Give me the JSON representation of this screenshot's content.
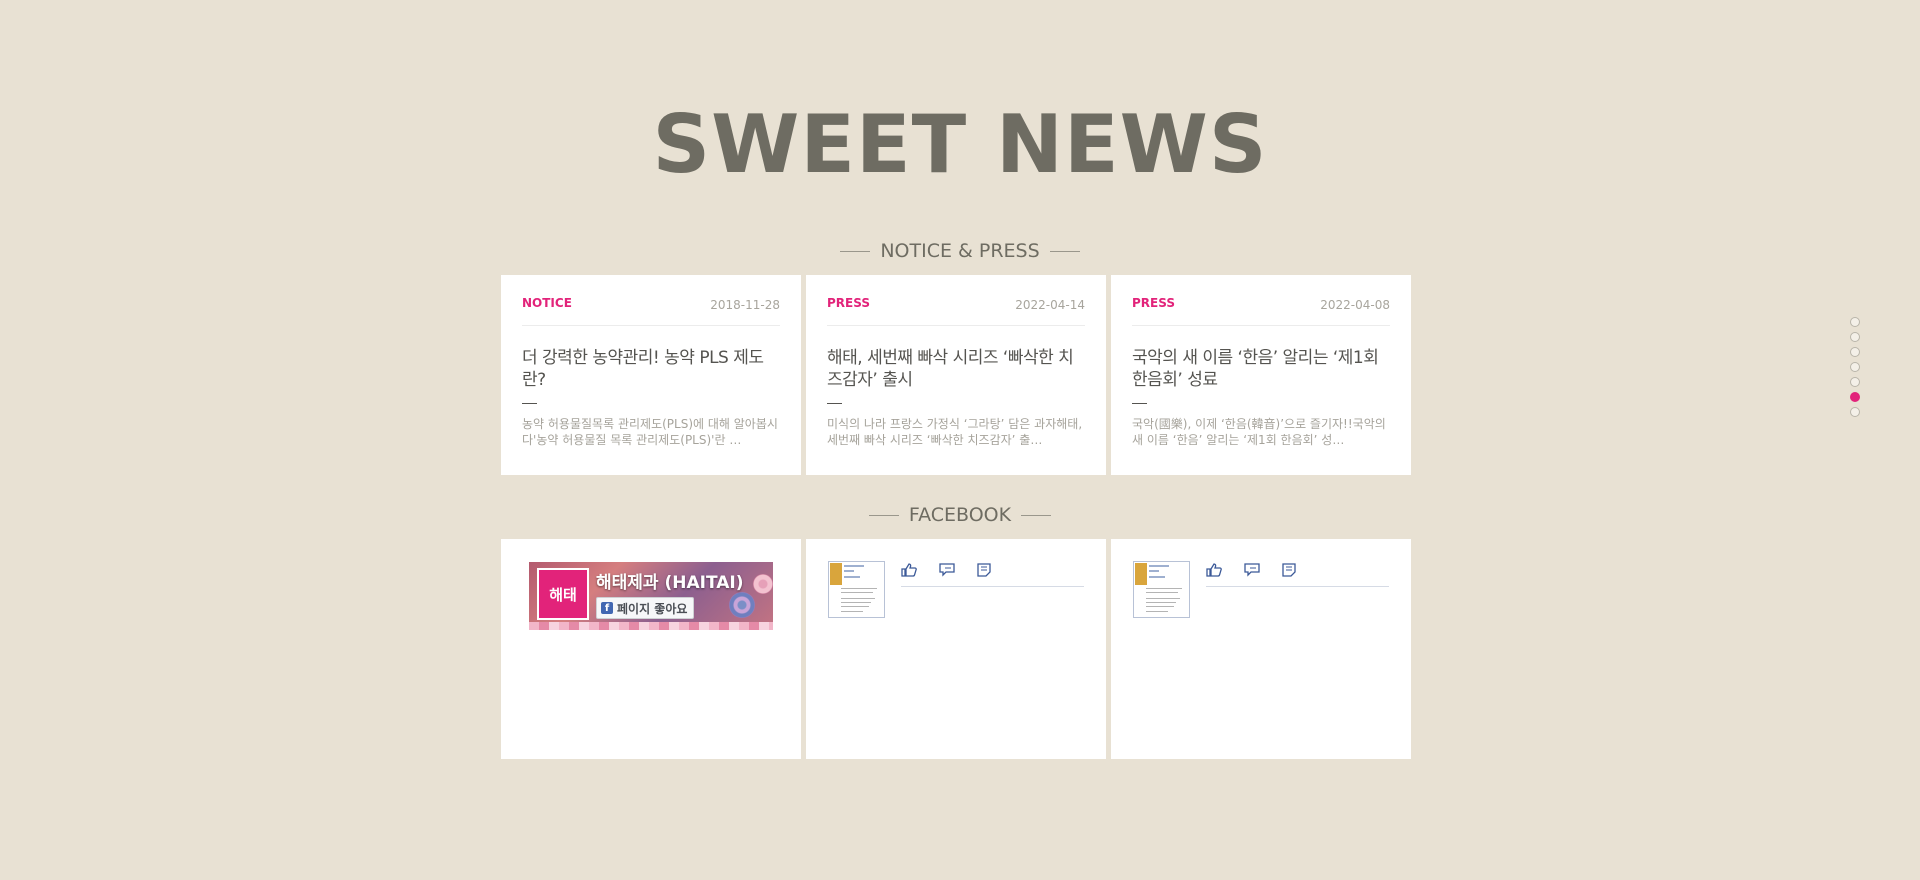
{
  "page": {
    "title": "SWEET NEWS"
  },
  "notice_section": {
    "heading": "NOTICE & PRESS",
    "cards": [
      {
        "category": "NOTICE",
        "date": "2018-11-28",
        "title": "더 강력한 농약관리! 농약 PLS 제도란?",
        "excerpt": "농약 허용물질목록 관리제도(PLS)에 대해 알아봅시다'농약 허용물질 목록 관리제도(PLS)'란 …"
      },
      {
        "category": "PRESS",
        "date": "2022-04-14",
        "title": "해태, 세번째 빠삭 시리즈 ‘빠삭한 치즈감자’ 출시",
        "excerpt": "미식의 나라 프랑스 가정식 ‘그라탕’ 담은 과자해태, 세번째 빠삭 시리즈 ‘빠삭한 치즈감자’ 출…"
      },
      {
        "category": "PRESS",
        "date": "2022-04-08",
        "title": "국악의 새 이름 ‘한음’ 알리는 ‘제1회 한음회’ 성료",
        "excerpt": "국악(國樂), 이제 ‘한음(韓音)’으로 즐기자!!국악의 새 이름 ‘한음’ 알리는 ‘제1회 한음회’ 성…"
      }
    ]
  },
  "facebook_section": {
    "heading": "FACEBOOK",
    "page_plugin": {
      "logo_text": "해태",
      "page_name": "해태제과 (HAITAI)",
      "like_label": "페이지 좋아요",
      "fb_glyph": "f"
    },
    "post_actions": [
      "like-icon",
      "comment-icon",
      "share-icon"
    ]
  },
  "pager": {
    "count": 7,
    "active_index": 5,
    "active_color": "#e2237a"
  },
  "colors": {
    "background": "#e8e1d3",
    "accent": "#e2237a",
    "title": "#6e6c62"
  }
}
